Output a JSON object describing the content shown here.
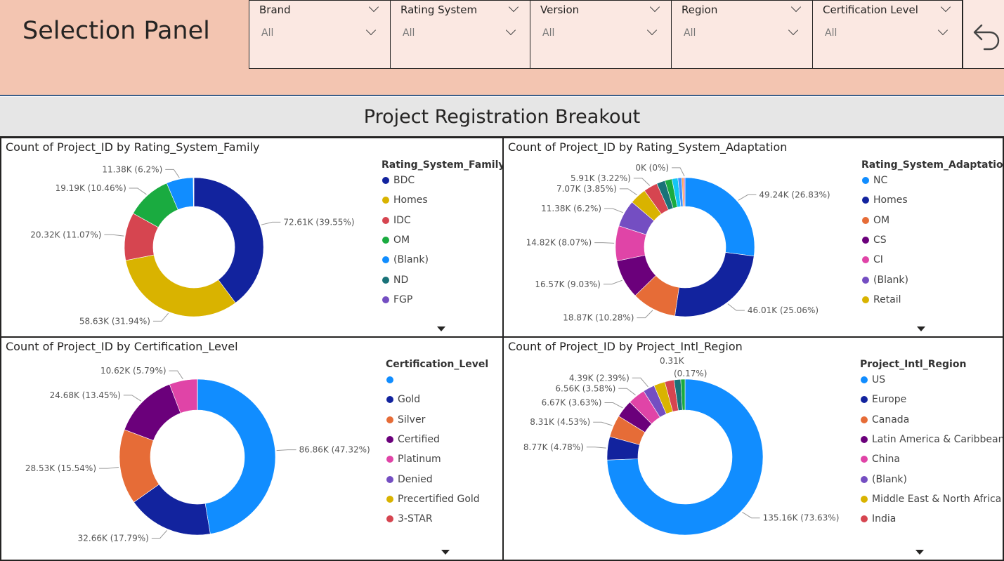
{
  "selection_panel": {
    "title": "Selection Panel",
    "slicers": [
      {
        "label": "Brand",
        "value": "All"
      },
      {
        "label": "Rating System",
        "value": "All"
      },
      {
        "label": "Version",
        "value": "All"
      },
      {
        "label": "Region",
        "value": "All"
      },
      {
        "label": "Certification Level",
        "value": "All"
      }
    ],
    "reset_icon": "undo-arrow-icon"
  },
  "banner": {
    "title": "Project Registration Breakout"
  },
  "chart_data": [
    {
      "type": "pie",
      "donut": true,
      "title": "Count of Project_ID by Rating_System_Family",
      "legend_title": "Rating_System_Family",
      "legend_position": "right",
      "categories": [
        "BDC",
        "Homes",
        "IDC",
        "OM",
        "(Blank)",
        "ND",
        "FGP"
      ],
      "colors": [
        "#12239e",
        "#d9b300",
        "#d64550",
        "#1aab40",
        "#118dff",
        "#197278",
        "#744ec2"
      ],
      "values": [
        72.61,
        58.63,
        20.32,
        19.19,
        11.38,
        0.2,
        0.1
      ],
      "unit": "K",
      "data_labels": [
        "72.61K (39.55%)",
        "58.63K (31.94%)",
        "20.32K (11.07%)",
        "19.19K (10.46%)",
        "11.38K (6.2%)",
        "",
        ""
      ]
    },
    {
      "type": "pie",
      "donut": true,
      "title": "Count of Project_ID by Rating_System_Adaptation",
      "legend_title": "Rating_System_Adaptation",
      "legend_position": "right",
      "categories": [
        "NC",
        "Homes",
        "OM",
        "CS",
        "CI",
        "(Blank)",
        "Retail"
      ],
      "colors": [
        "#118dff",
        "#12239e",
        "#e66c37",
        "#6b007b",
        "#e044a7",
        "#744ec2",
        "#d9b300",
        "#d64550",
        "#197278",
        "#1aab40",
        "#15c6f4",
        "#4092ff",
        "#ffa058",
        "#be5dc9"
      ],
      "values": [
        49.24,
        46.01,
        18.87,
        16.57,
        14.82,
        11.38,
        7.07,
        5.91,
        3.6,
        3.0,
        2.5,
        1.6,
        0.9,
        0.5
      ],
      "unit": "K",
      "data_labels": [
        "49.24K (26.83%)",
        "46.01K (25.06%)",
        "18.87K (10.28%)",
        "16.57K (9.03%)",
        "14.82K (8.07%)",
        "11.38K (6.2%)",
        "7.07K (3.85%)",
        "5.91K (3.22%)",
        "",
        "",
        "",
        "",
        "",
        "0K (0%)"
      ]
    },
    {
      "type": "pie",
      "donut": true,
      "title": "Count of Project_ID by Certification_Level",
      "legend_title": "Certification_Level",
      "legend_position": "right",
      "categories": [
        "",
        "Gold",
        "Silver",
        "Certified",
        "Platinum",
        "Denied",
        "Precertified Gold",
        "3-STAR"
      ],
      "colors": [
        "#118dff",
        "#12239e",
        "#e66c37",
        "#6b007b",
        "#e044a7",
        "#744ec2",
        "#d9b300",
        "#d64550"
      ],
      "values": [
        86.86,
        32.66,
        28.53,
        24.68,
        10.62,
        0.02,
        0.02,
        0.01
      ],
      "unit": "K",
      "data_labels": [
        "86.86K (47.32%)",
        "32.66K (17.79%)",
        "28.53K (15.54%)",
        "24.68K (13.45%)",
        "10.62K (5.79%)",
        "",
        "",
        ""
      ]
    },
    {
      "type": "pie",
      "donut": true,
      "title": "Count of Project_ID by Project_Intl_Region",
      "legend_title": "Project_Intl_Region",
      "legend_position": "right",
      "categories": [
        "US",
        "Europe",
        "Canada",
        "Latin America & Caribbean",
        "China",
        "(Blank)",
        "Middle East & North Africa",
        "India"
      ],
      "colors": [
        "#118dff",
        "#12239e",
        "#e66c37",
        "#6b007b",
        "#e044a7",
        "#744ec2",
        "#d9b300",
        "#d64550",
        "#197278",
        "#1aab40"
      ],
      "values": [
        135.16,
        8.77,
        8.31,
        6.67,
        6.56,
        4.39,
        4.2,
        3.5,
        2.5,
        1.6
      ],
      "unit": "K",
      "data_labels": [
        "135.16K (73.63%)",
        "8.77K (4.78%)",
        "8.31K (4.53%)",
        "6.67K (3.63%)",
        "6.56K (3.58%)",
        "4.39K (2.39%)",
        "",
        "",
        "",
        ""
      ],
      "extra_labels": [
        "0.31K",
        "(0.17%)"
      ]
    }
  ]
}
